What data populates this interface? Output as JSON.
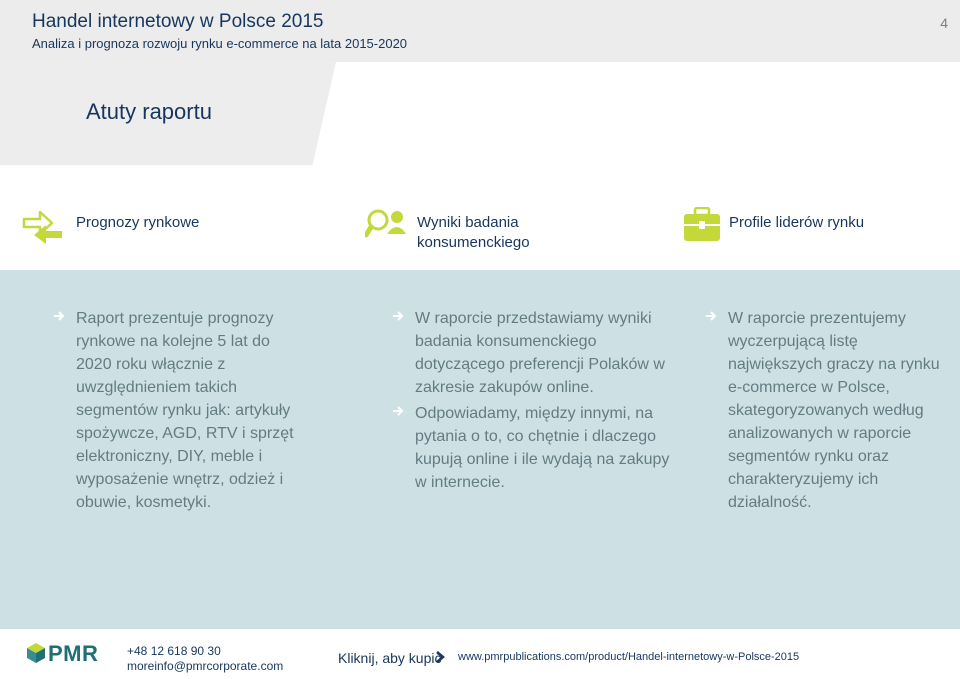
{
  "header": {
    "title": "Handel internetowy w Polsce 2015",
    "subtitle": "Analiza i prognoza rozwoju rynku e-commerce na lata 2015-2020",
    "page_number": "4"
  },
  "section": {
    "title": "Atuty raportu"
  },
  "features": [
    {
      "label": "Prognozy rynkowe",
      "icon": "arrows-exchange-icon"
    },
    {
      "label": "Wyniki badania konsumenckiego",
      "icon": "magnifier-person-icon"
    },
    {
      "label": "Profile liderów rynku",
      "icon": "briefcase-icon"
    }
  ],
  "columns": [
    {
      "bullets": [
        "Raport prezentuje prognozy rynkowe na kolejne 5 lat do 2020 roku włącznie z uwzględnieniem takich segmentów rynku jak: artykuły spożywcze, AGD, RTV i sprzęt elektroniczny, DIY, meble i wyposażenie wnętrz, odzież i obuwie, kosmetyki."
      ]
    },
    {
      "bullets": [
        "W raporcie przedstawiamy wyniki badania konsumenckiego dotyczącego preferencji Polaków w zakresie zakupów online.",
        "Odpowiadamy, między innymi, na pytania o to, co chętnie i dlaczego kupują online i ile wydają na zakupy w internecie."
      ]
    },
    {
      "bullets": [
        "W raporcie prezentujemy wyczerpującą listę największych graczy na rynku e-commerce w Polsce, skategoryzowanych według analizowanych w raporcie segmentów rynku oraz charakteryzujemy ich działalność."
      ]
    }
  ],
  "footer": {
    "logo_text": "PMR",
    "phone": "+48 12 618 90 30",
    "email": "moreinfo@pmrcorporate.com",
    "buy_link": "Kliknij, aby kupić",
    "url": "www.pmrpublications.com/product/Handel-internetowy-w-Polsce-2015"
  },
  "colors": {
    "accent_green": "#c5d83a",
    "content_bg": "#cde1e5",
    "text_navy": "#17365d",
    "body_text": "#637c82"
  }
}
